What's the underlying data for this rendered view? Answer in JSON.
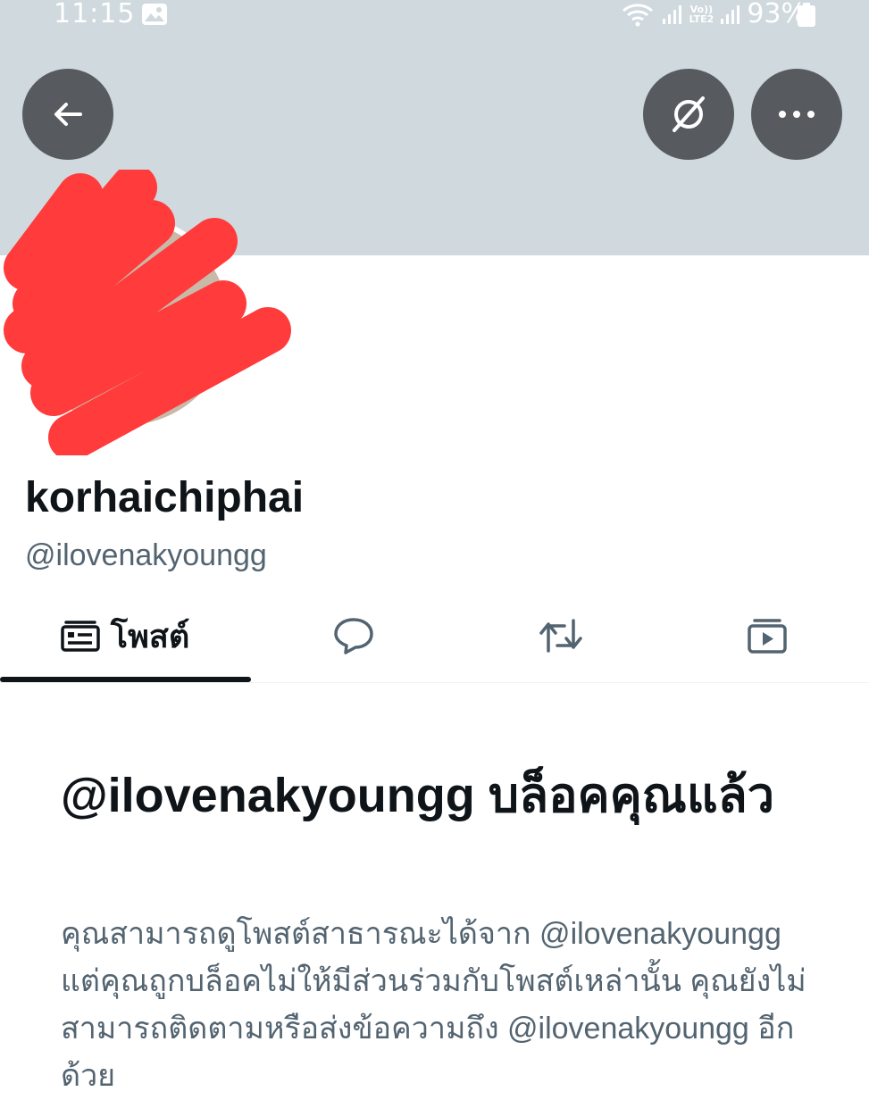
{
  "status_bar": {
    "time": "11:15",
    "network": "LTE2",
    "volte": "Vo))",
    "battery": "93%"
  },
  "header": {
    "back_icon": "arrow-left-icon",
    "grok_icon": "grok-icon",
    "more_icon": "more-horizontal-icon"
  },
  "profile": {
    "display_name": "korhaichiphai",
    "handle": "@ilovenakyoungg"
  },
  "tabs": [
    {
      "label": "โพสต์",
      "icon": "posts-icon",
      "selected": true
    },
    {
      "label": "",
      "icon": "reply-bubble-icon",
      "selected": false
    },
    {
      "label": "",
      "icon": "repost-icon",
      "selected": false
    },
    {
      "label": "",
      "icon": "media-icon",
      "selected": false
    }
  ],
  "blocked": {
    "title": "@ilovenakyoungg บล็อคคุณแล้ว",
    "description": "คุณสามารถดูโพสต์สาธารณะได้จาก @ilovenakyoungg แต่คุณถูกบล็อคไม่ให้มีส่วนร่วมกับโพสต์เหล่านั้น คุณยังไม่สามารถติดตามหรือส่งข้อความถึง @ilovenakyoungg อีกด้วย"
  },
  "colors": {
    "banner": "#cfd9de",
    "secondary_text": "#536471",
    "primary_text": "#0f1419",
    "redaction": "#ff3b3b"
  }
}
